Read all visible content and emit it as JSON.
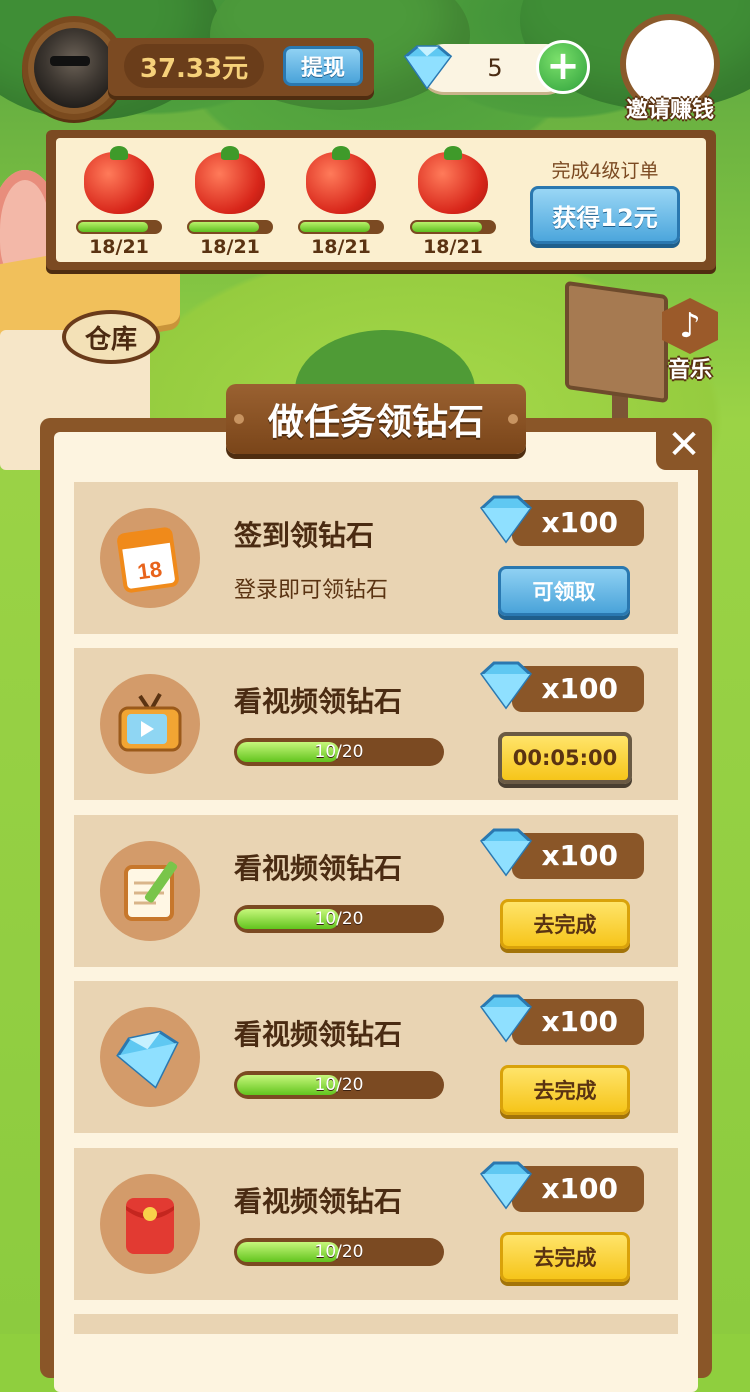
{
  "header": {
    "balance": "37.33元",
    "withdraw_label": "提现",
    "gem_count": "5",
    "invite_label": "邀请赚钱"
  },
  "order": {
    "items": [
      {
        "progress": "18/21",
        "fraction": 0.857
      },
      {
        "progress": "18/21",
        "fraction": 0.857
      },
      {
        "progress": "18/21",
        "fraction": 0.857
      },
      {
        "progress": "18/21",
        "fraction": 0.857
      }
    ],
    "caption": "完成4级订单",
    "button_label": "获得12元"
  },
  "scene": {
    "warehouse_sign": "仓库",
    "music_label": "音乐"
  },
  "dialog": {
    "title": "做任务领钻石",
    "close_symbol": "✕",
    "tasks": [
      {
        "title": "签到领钻石",
        "subtitle": "登录即可领钻石",
        "reward": "x100",
        "button": "可领取",
        "icon": "calendar-icon"
      },
      {
        "title": "看视频领钻石",
        "progress": "10/20",
        "fraction": 0.5,
        "reward": "x100",
        "button": "00:05:00",
        "icon": "tv-icon"
      },
      {
        "title": "看视频领钻石",
        "progress": "10/20",
        "fraction": 0.5,
        "reward": "x100",
        "button": "去完成",
        "icon": "notepad-icon"
      },
      {
        "title": "看视频领钻石",
        "progress": "10/20",
        "fraction": 0.5,
        "reward": "x100",
        "button": "去完成",
        "icon": "diamond-icon"
      },
      {
        "title": "看视频领钻石",
        "progress": "10/20",
        "fraction": 0.5,
        "reward": "x100",
        "button": "去完成",
        "icon": "red-envelope-icon"
      }
    ]
  },
  "colors": {
    "wood": "#8a5628",
    "panel": "#fdf4e0",
    "blue_button": "#4aa3d9",
    "yellow_button": "#f6c51a",
    "progress_green": "#62c41e"
  }
}
